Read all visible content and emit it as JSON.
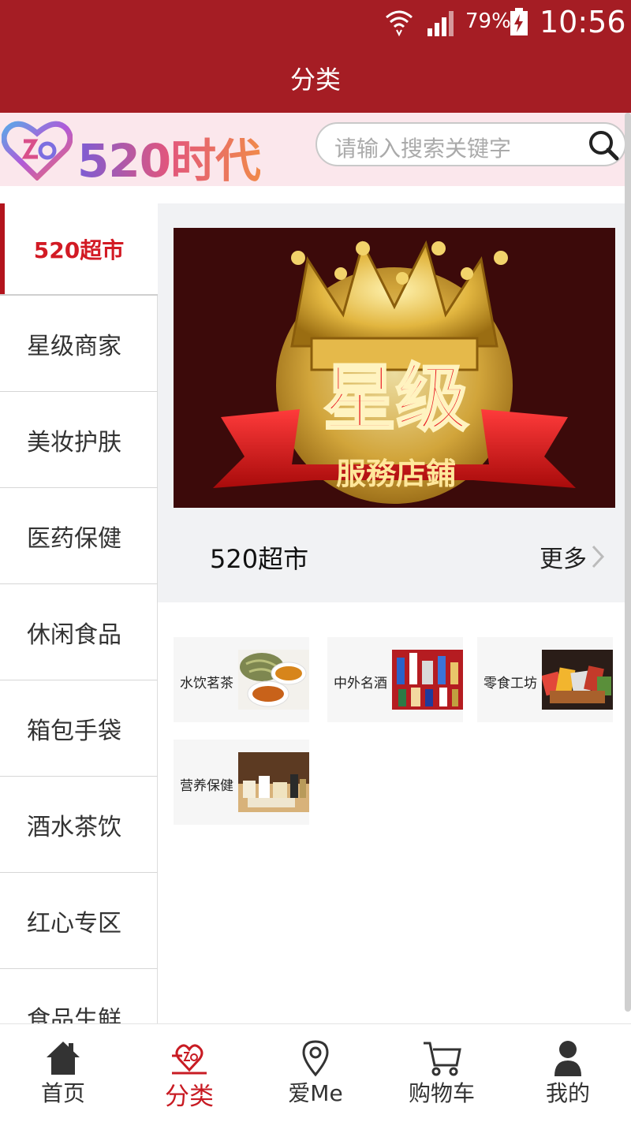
{
  "status": {
    "battery": "79%",
    "time": "10:56"
  },
  "header": {
    "title": "分类"
  },
  "brand": {
    "logo_text": "520时代",
    "search_placeholder": "请输入搜索关键字"
  },
  "sidebar": {
    "items": [
      {
        "label": "520超市",
        "active": true
      },
      {
        "label": "星级商家"
      },
      {
        "label": "美妆护肤"
      },
      {
        "label": "医药保健"
      },
      {
        "label": "休闲食品"
      },
      {
        "label": "箱包手袋"
      },
      {
        "label": "酒水茶饮"
      },
      {
        "label": "红心专区"
      },
      {
        "label": "食品生鲜"
      }
    ]
  },
  "main": {
    "banner": {
      "headline": "星级",
      "subline": "服務店鋪"
    },
    "section_title": "520超市",
    "more_label": "更多",
    "tiles": [
      {
        "label": "水饮茗茶"
      },
      {
        "label": "中外名酒"
      },
      {
        "label": "零食工坊"
      },
      {
        "label": "营养保健"
      }
    ]
  },
  "nav": {
    "items": [
      {
        "label": "首页",
        "icon": "home-icon"
      },
      {
        "label": "分类",
        "icon": "category-logo-icon",
        "active": true
      },
      {
        "label": "爱Me",
        "icon": "location-pin-icon"
      },
      {
        "label": "购物车",
        "icon": "cart-icon"
      },
      {
        "label": "我的",
        "icon": "user-icon"
      }
    ]
  },
  "colors": {
    "brand_red": "#a51d24",
    "active_red": "#d21a24"
  }
}
